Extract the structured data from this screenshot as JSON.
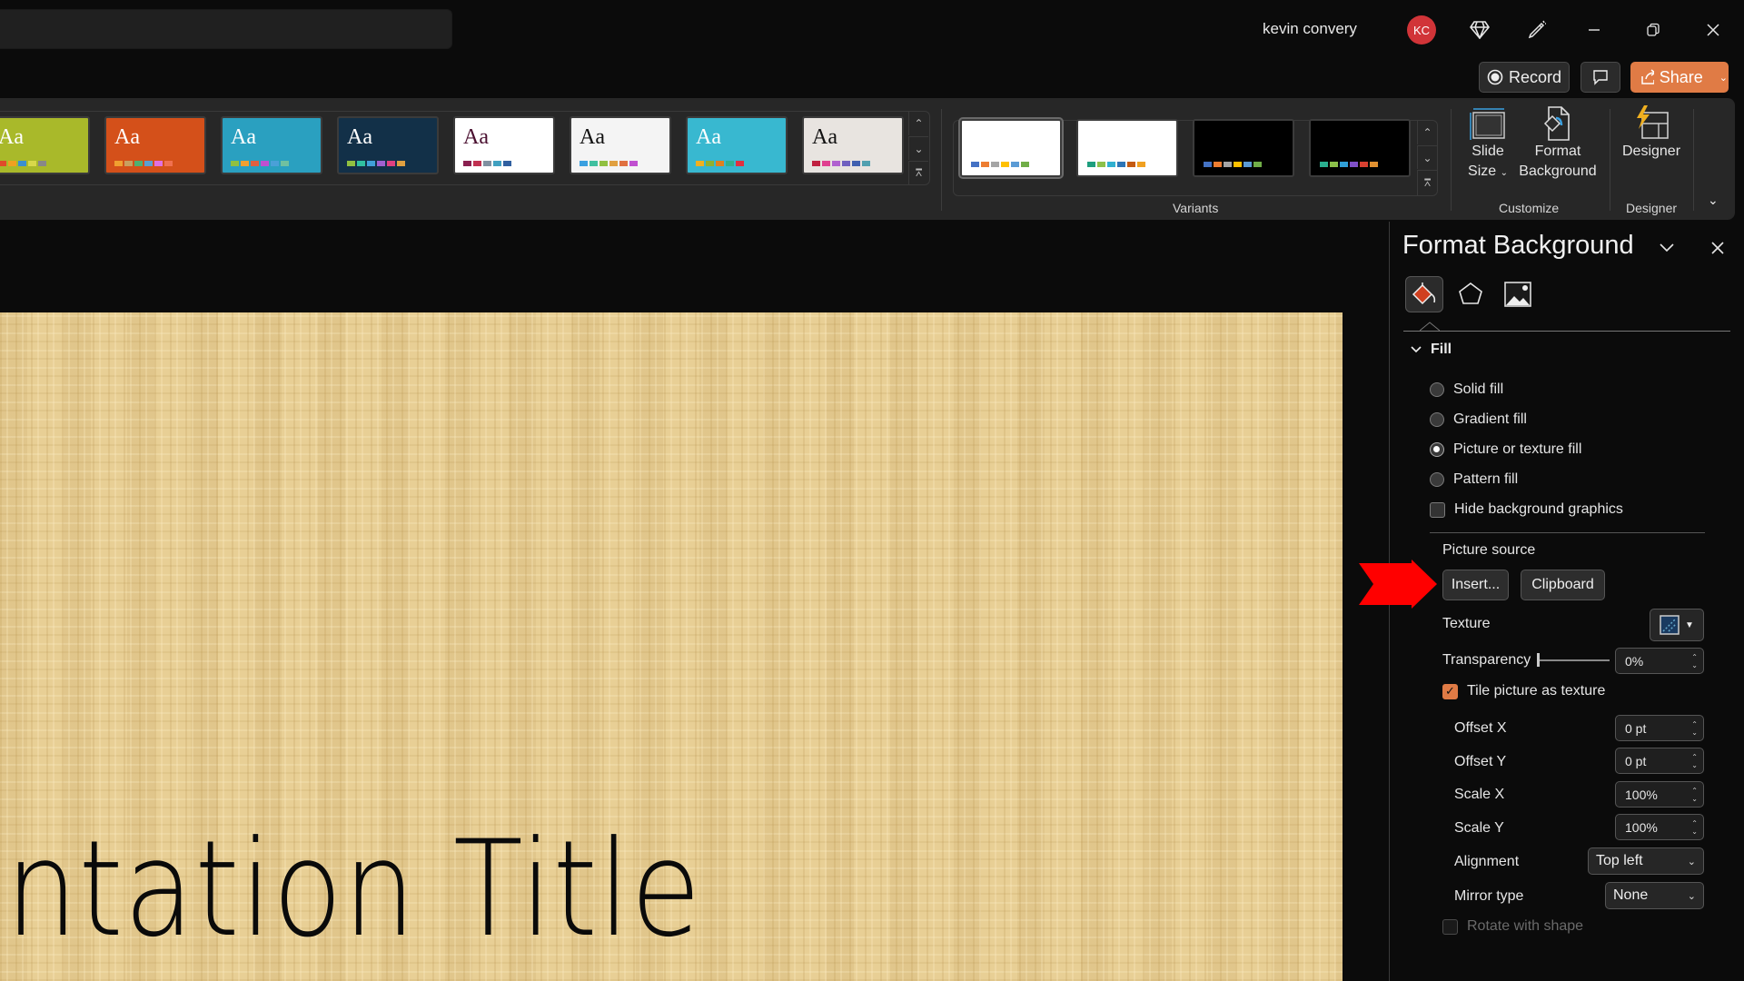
{
  "titlebar": {
    "user_name": "kevin convery",
    "avatar_initials": "KC",
    "avatar_color": "#d13438",
    "icons": [
      "premium-diamond-icon",
      "designer-pen-icon",
      "minimize-icon",
      "restore-icon",
      "close-icon"
    ]
  },
  "actions": {
    "record_label": "Record",
    "share_label": "Share",
    "share_color": "#e07b45"
  },
  "ribbon": {
    "themes": [
      {
        "name": "theme-lime",
        "bg": "#a9b92a",
        "text": "#ffffff",
        "swatches": [
          "#e04a2a",
          "#f0a020",
          "#3b8fd0",
          "#d8d84a",
          "#888888"
        ]
      },
      {
        "name": "theme-orange",
        "bg": "#d4501a",
        "text": "#ffffff",
        "swatches": [
          "#f0a030",
          "#c8a060",
          "#50b070",
          "#5aa0d0",
          "#e070e0",
          "#f07050"
        ]
      },
      {
        "name": "theme-teal",
        "bg": "#2aa0c0",
        "text": "#ffffff",
        "swatches": [
          "#90c040",
          "#f0a030",
          "#e06040",
          "#c050d0",
          "#4aa0d8",
          "#70c0a0"
        ]
      },
      {
        "name": "theme-navy",
        "bg": "#123048",
        "text": "#ffffff",
        "swatches": [
          "#90c040",
          "#30c0a0",
          "#40a0d8",
          "#a060d0",
          "#e04080",
          "#e0a040"
        ]
      },
      {
        "name": "theme-plum",
        "bg": "#ffffff",
        "text": "#4a1030",
        "swatches": [
          "#8a2050",
          "#c03050",
          "#8090a0",
          "#40a0c0",
          "#3060a0"
        ]
      },
      {
        "name": "theme-droplet",
        "bg": "#f4f4f4",
        "text": "#111111",
        "swatches": [
          "#3aa0e0",
          "#40c0a0",
          "#90c040",
          "#e0a040",
          "#e07040",
          "#c050d0"
        ]
      },
      {
        "name": "theme-cyan",
        "bg": "#38b8d0",
        "text": "#ffffff",
        "swatches": [
          "#f0b020",
          "#90b030",
          "#e08020",
          "#30b090",
          "#e03040"
        ]
      },
      {
        "name": "theme-wood",
        "bg": "#e8e4e0",
        "text": "#111111",
        "swatches": [
          "#c02040",
          "#e04090",
          "#b060d0",
          "#7060c0",
          "#4060b0",
          "#50a0b0"
        ]
      }
    ],
    "variants": [
      {
        "name": "variant-white-1",
        "bg": "#ffffff",
        "swatches": [
          "#4472c4",
          "#ed7d31",
          "#a5a5a5",
          "#ffc000",
          "#5b9bd5",
          "#70ad47"
        ]
      },
      {
        "name": "variant-white-2",
        "bg": "#ffffff",
        "swatches": [
          "#1e9e7e",
          "#8cc04a",
          "#30b0d0",
          "#2e75b6",
          "#c55a11",
          "#f0a020"
        ]
      },
      {
        "name": "variant-black-1",
        "bg": "#000000",
        "swatches": [
          "#4472c4",
          "#ed7d31",
          "#a5a5a5",
          "#ffc000",
          "#5b9bd5",
          "#70ad47"
        ]
      },
      {
        "name": "variant-black-2",
        "bg": "#000000",
        "swatches": [
          "#2ab090",
          "#8cc04a",
          "#30a0d8",
          "#8050c8",
          "#d84030",
          "#e09030"
        ]
      }
    ],
    "variants_label": "Variants",
    "slide_size_line1": "Slide",
    "slide_size_line2": "Size",
    "format_bg_line1": "Format",
    "format_bg_line2": "Background",
    "customize_label": "Customize",
    "designer_btn_label": "Designer",
    "designer_group_label": "Designer"
  },
  "slide": {
    "title_text": "ntation Title",
    "texture_color": "#e8cf95"
  },
  "panel": {
    "title": "Format Background",
    "tabs": [
      "fill-tab",
      "effects-tab",
      "picture-tab"
    ],
    "fill_section": "Fill",
    "fill_options": [
      {
        "label": "Solid fill",
        "selected": false
      },
      {
        "label": "Gradient fill",
        "selected": false
      },
      {
        "label": "Picture or texture fill",
        "selected": true
      },
      {
        "label": "Pattern fill",
        "selected": false
      }
    ],
    "hide_bg_graphics": {
      "label": "Hide background graphics",
      "checked": false
    },
    "picture_source_label": "Picture source",
    "insert_label": "Insert...",
    "clipboard_label": "Clipboard",
    "texture_label": "Texture",
    "transparency_label": "Transparency",
    "transparency_value": "0%",
    "transparency_fraction": 0,
    "tile_label": "Tile picture as texture",
    "tile_checked": true,
    "offset_x_label": "Offset X",
    "offset_x_value": "0 pt",
    "offset_y_label": "Offset Y",
    "offset_y_value": "0 pt",
    "scale_x_label": "Scale X",
    "scale_x_value": "100%",
    "scale_y_label": "Scale Y",
    "scale_y_value": "100%",
    "alignment_label": "Alignment",
    "alignment_value": "Top left",
    "mirror_label": "Mirror type",
    "mirror_value": "None",
    "rotate_label": "Rotate with shape",
    "rotate_checked": false,
    "rotate_disabled": true
  },
  "annotation": {
    "arrow_color": "#ff0000",
    "points_to": "insert-button"
  }
}
